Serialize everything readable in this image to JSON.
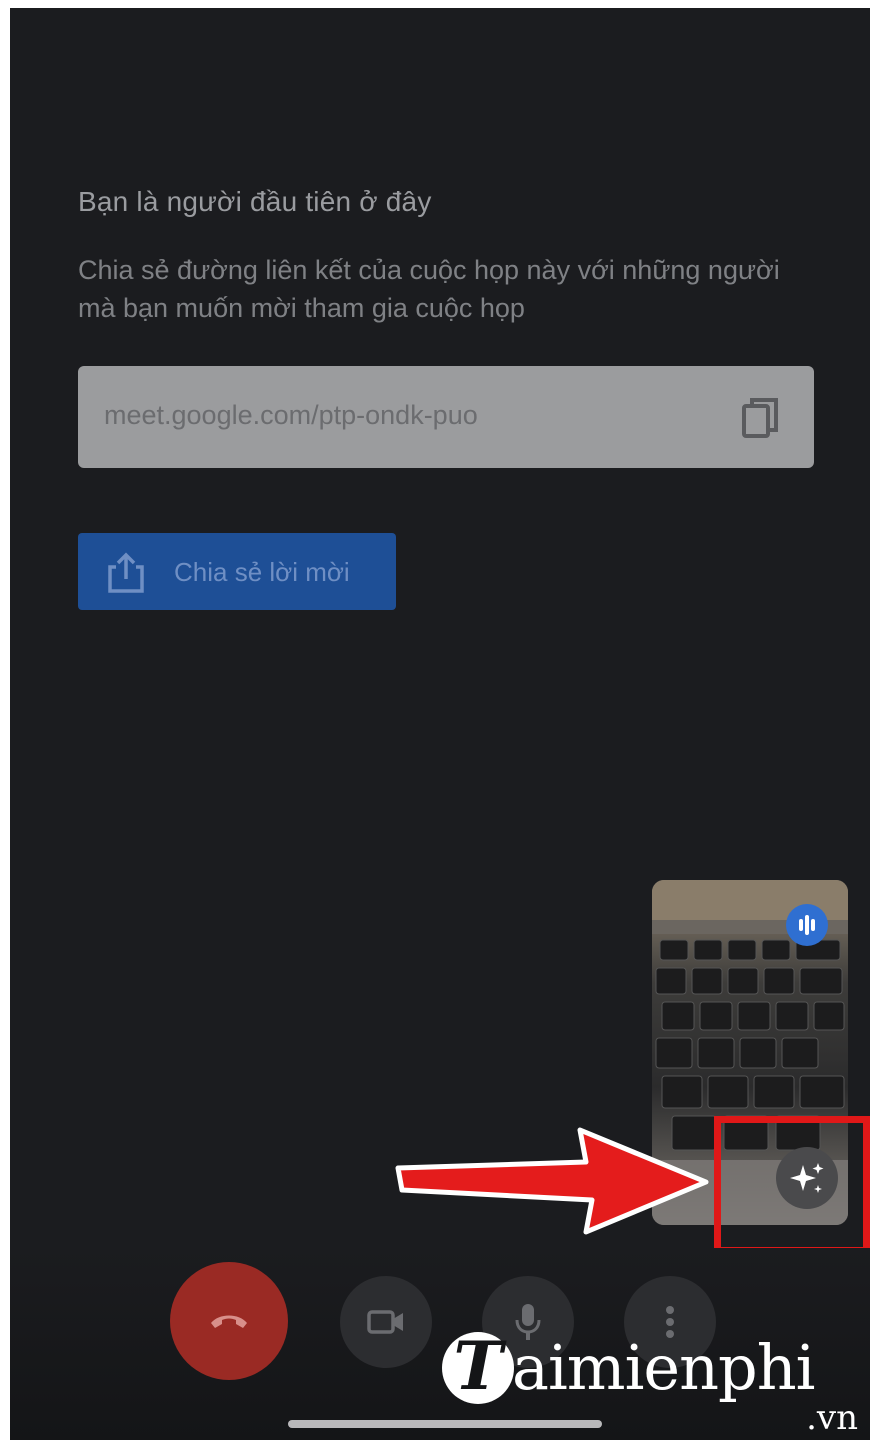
{
  "meeting": {
    "title": "Bạn là người đầu tiên ở đây",
    "description": "Chia sẻ đường liên kết của cuộc họp này với những người mà bạn muốn mời tham gia cuộc họp",
    "link": "meet.google.com/ptp-ondk-puo",
    "share_button_label": "Chia sẻ lời mời"
  },
  "icons": {
    "copy": "copy-icon",
    "share": "share-icon",
    "speaking": "audio-level-icon",
    "effects": "sparkle-effects-icon",
    "end_call": "end-call-icon",
    "camera": "video-camera-icon",
    "mic": "microphone-icon",
    "more": "more-vert-icon"
  },
  "colors": {
    "background": "#1b1c1f",
    "share_button": "#1e4f96",
    "end_call": "#9a2a24",
    "highlight": "#e01818",
    "speaking_badge": "#2f6fd1"
  },
  "watermark": {
    "initial": "T",
    "name": "aimienphi",
    "domain": ".vn"
  }
}
